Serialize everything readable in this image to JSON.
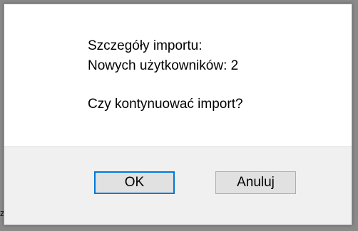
{
  "background": {
    "visible_fragment": "z"
  },
  "dialog": {
    "message_lines": [
      "Szczegóły importu:",
      "Nowych użytkowników: 2",
      "Czy kontynuować import?"
    ],
    "buttons": {
      "ok_label": "OK",
      "cancel_label": "Anuluj"
    }
  },
  "colors": {
    "dialog_background": "#ffffff",
    "footer_background": "#f0f0f0",
    "button_face": "#e1e1e1",
    "default_button_border": "#0078d7"
  }
}
